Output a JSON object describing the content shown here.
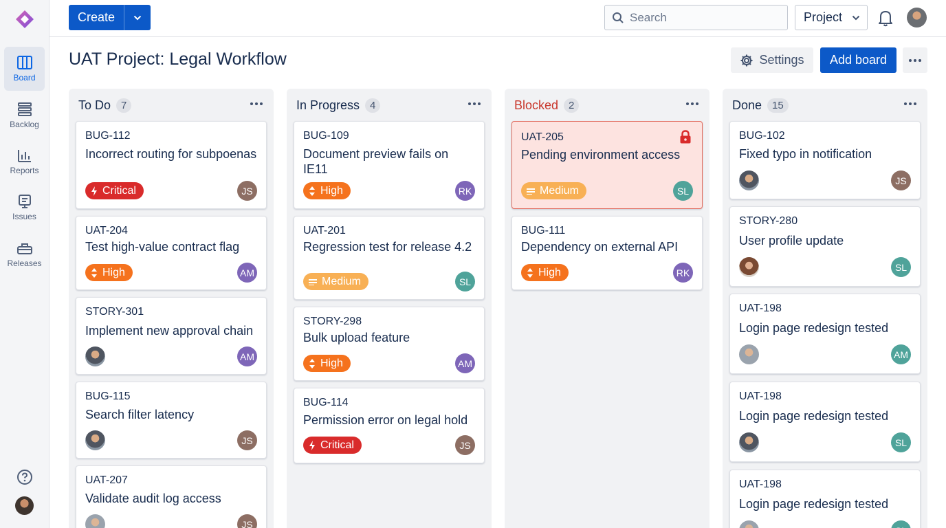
{
  "sidebar": {
    "items": [
      {
        "label": "Board",
        "icon": "board-icon",
        "active": true
      },
      {
        "label": "Backlog",
        "icon": "backlog-icon"
      },
      {
        "label": "Reports",
        "icon": "reports-icon"
      },
      {
        "label": "Issues",
        "icon": "issues-icon"
      },
      {
        "label": "Releases",
        "icon": "releases-icon"
      }
    ]
  },
  "topbar": {
    "create_label": "Create",
    "search_placeholder": "Search",
    "project_label": "Project"
  },
  "header": {
    "title": "UAT Project: Legal Workflow",
    "settings_label": "Settings",
    "add_board_label": "Add board"
  },
  "colors": {
    "primary": "#0c59c8",
    "critical": "#d92b2b",
    "high": "#f5721d",
    "medium": "#f8b055",
    "blocked_text": "#c9372c",
    "avatar_JS": "#8d6e63",
    "avatar_AM": "#7e66b8",
    "avatar_RK": "#7e66b8",
    "avatar_SL": "#4fa39a"
  },
  "columns": [
    {
      "name": "To Do",
      "count": "7",
      "cards": [
        {
          "key": "BUG-112",
          "title": "Incorrect routing for subpoenas",
          "priority": "Critical",
          "assignee": "JS"
        },
        {
          "key": "UAT-204",
          "title": "Test high-value contract flag",
          "priority": "High",
          "assignee": "AM"
        },
        {
          "key": "STORY-301",
          "title": "Implement new approval chain",
          "assignee": "AM"
        },
        {
          "key": "BUG-115",
          "title": "Search filter latency",
          "assignee": "JS"
        },
        {
          "key": "UAT-207",
          "title": "Validate audit log access",
          "assignee": "JS"
        }
      ]
    },
    {
      "name": "In Progress",
      "count": "4",
      "cards": [
        {
          "key": "BUG-109",
          "title": "Document preview fails on IE11",
          "priority": "High",
          "assignee": "RK"
        },
        {
          "key": "UAT-201",
          "title": "Regression test for release 4.2",
          "priority": "Medium",
          "assignee": "SL"
        },
        {
          "key": "STORY-298",
          "title": "Bulk upload feature",
          "priority": "High",
          "assignee": "AM"
        },
        {
          "key": "BUG-114",
          "title": "Permission error on legal hold",
          "priority": "Critical",
          "assignee": "JS"
        }
      ]
    },
    {
      "name": "Blocked",
      "count": "2",
      "cards": [
        {
          "key": "UAT-205",
          "title": "Pending environment access",
          "priority": "Medium",
          "assignee": "SL"
        },
        {
          "key": "BUG-111",
          "title": "Dependency on external API",
          "priority": "High",
          "assignee": "RK"
        }
      ]
    },
    {
      "name": "Done",
      "count": "15",
      "cards": [
        {
          "key": "BUG-102",
          "title": "Fixed typo in notification",
          "assignee": "JS"
        },
        {
          "key": "STORY-280",
          "title": "User profile update",
          "assignee": "SL"
        },
        {
          "key": "UAT-198",
          "title": "Login page redesign tested",
          "assignee": "AM"
        },
        {
          "key": "UAT-198",
          "title": "Login page redesign tested",
          "assignee": "SL"
        },
        {
          "key": "UAT-198",
          "title": "Login page redesign tested",
          "assignee": "SL"
        }
      ]
    }
  ]
}
